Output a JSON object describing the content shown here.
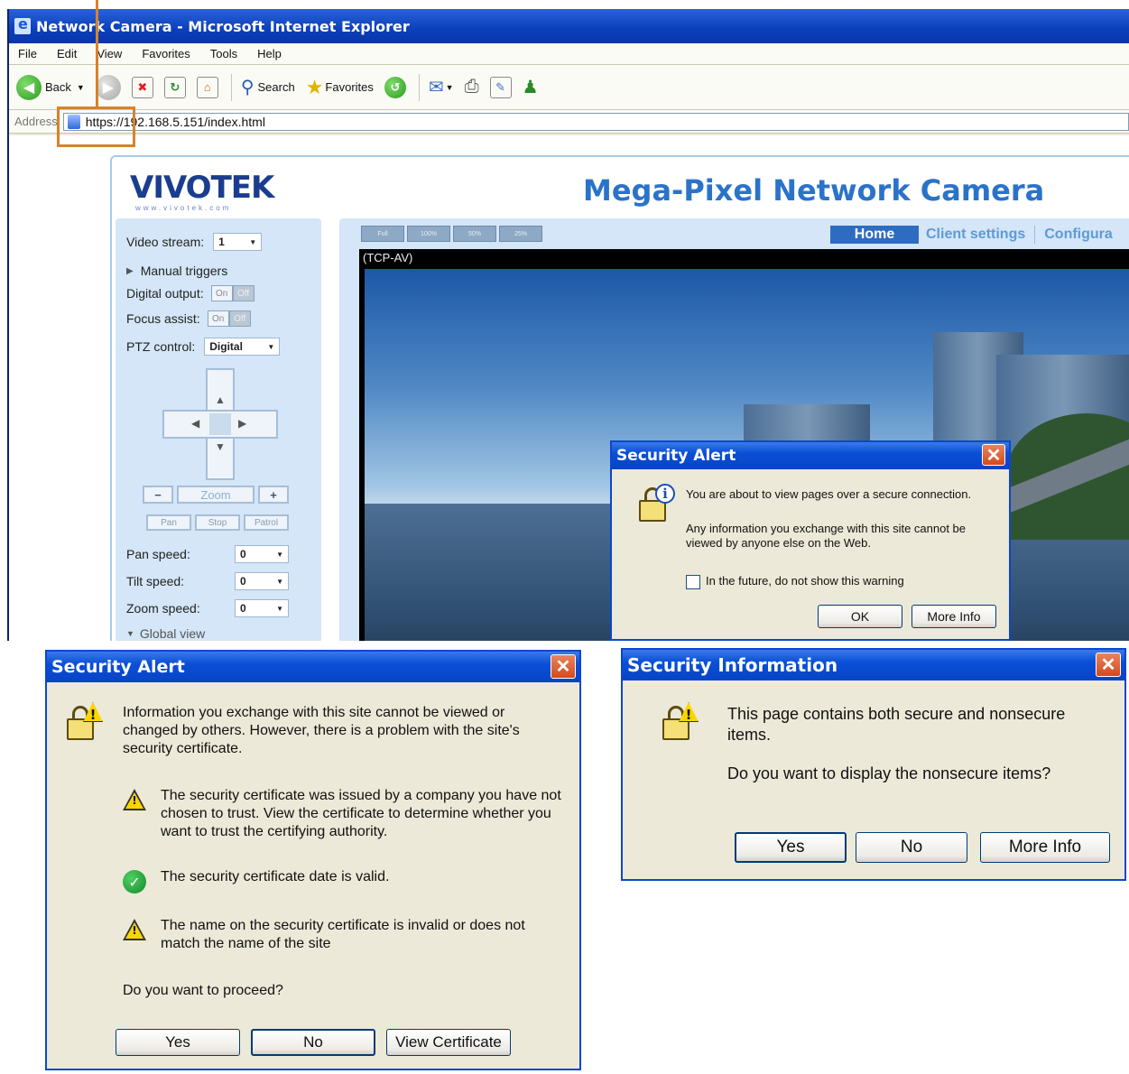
{
  "browser": {
    "title": "Network Camera - Microsoft Internet Explorer",
    "menu": [
      "File",
      "Edit",
      "View",
      "Favorites",
      "Tools",
      "Help"
    ],
    "toolbar": {
      "back": "Back",
      "search": "Search",
      "favorites": "Favorites"
    },
    "address_label": "Address",
    "url": "https://192.168.5.151/index.html"
  },
  "camera": {
    "logo": "VIVOTEK",
    "logo_sub": "www.vivotek.com",
    "title": "Mega-Pixel Network Camera",
    "nav": [
      "Home",
      "Client settings",
      "Configura"
    ],
    "video_label": "(TCP-AV)",
    "size_tabs": [
      "Full",
      "100%",
      "50%",
      "25%"
    ],
    "side": {
      "video_stream_label": "Video stream:",
      "video_stream_value": "1",
      "manual_triggers": "Manual triggers",
      "digital_output": "Digital output:",
      "focus_assist": "Focus assist:",
      "on": "On",
      "off": "Off",
      "ptz_control": "PTZ control:",
      "ptz_value": "Digital",
      "zoom": "Zoom",
      "pan": "Pan",
      "stop": "Stop",
      "patrol": "Patrol",
      "pan_speed": "Pan speed:",
      "tilt_speed": "Tilt speed:",
      "zoom_speed": "Zoom speed:",
      "speed_value": "0",
      "global_view": "Global view"
    }
  },
  "alert_small": {
    "title": "Security Alert",
    "line1": "You are about to view pages over a secure connection.",
    "line2": "Any information you exchange with this site cannot be viewed by anyone else on the Web.",
    "checkbox": "In the future, do not show this warning",
    "ok": "OK",
    "more_info": "More Info"
  },
  "alert_cert": {
    "title": "Security Alert",
    "intro": "Information you exchange with this site cannot be viewed or changed by others. However, there is a problem with the site's security certificate.",
    "item1": "The security certificate was issued by a company you have not chosen to trust. View the certificate to determine whether you want to trust the certifying authority.",
    "item2": "The security certificate date is valid.",
    "item3": "The name on the security certificate is invalid or does not match the name of the site",
    "question": "Do you want to proceed?",
    "yes": "Yes",
    "no": "No",
    "view_cert": "View Certificate"
  },
  "security_info": {
    "title": "Security Information",
    "line1": "This page contains both secure and nonsecure items.",
    "line2": "Do you want to display the nonsecure items?",
    "yes": "Yes",
    "no": "No",
    "more_info": "More Info"
  },
  "colors": {
    "xp_blue": "#0a4fd7",
    "callout": "#d6832b",
    "camera_title": "#2b73c9"
  },
  "icons": [
    "ie-icon",
    "back-icon",
    "forward-icon",
    "stop-icon",
    "refresh-icon",
    "home-icon",
    "search-icon",
    "favorites-icon",
    "history-icon",
    "mail-icon",
    "print-icon",
    "edit-icon",
    "messenger-icon",
    "lock-warning-icon",
    "lock-info-icon",
    "warning-icon",
    "check-icon",
    "close-icon"
  ]
}
